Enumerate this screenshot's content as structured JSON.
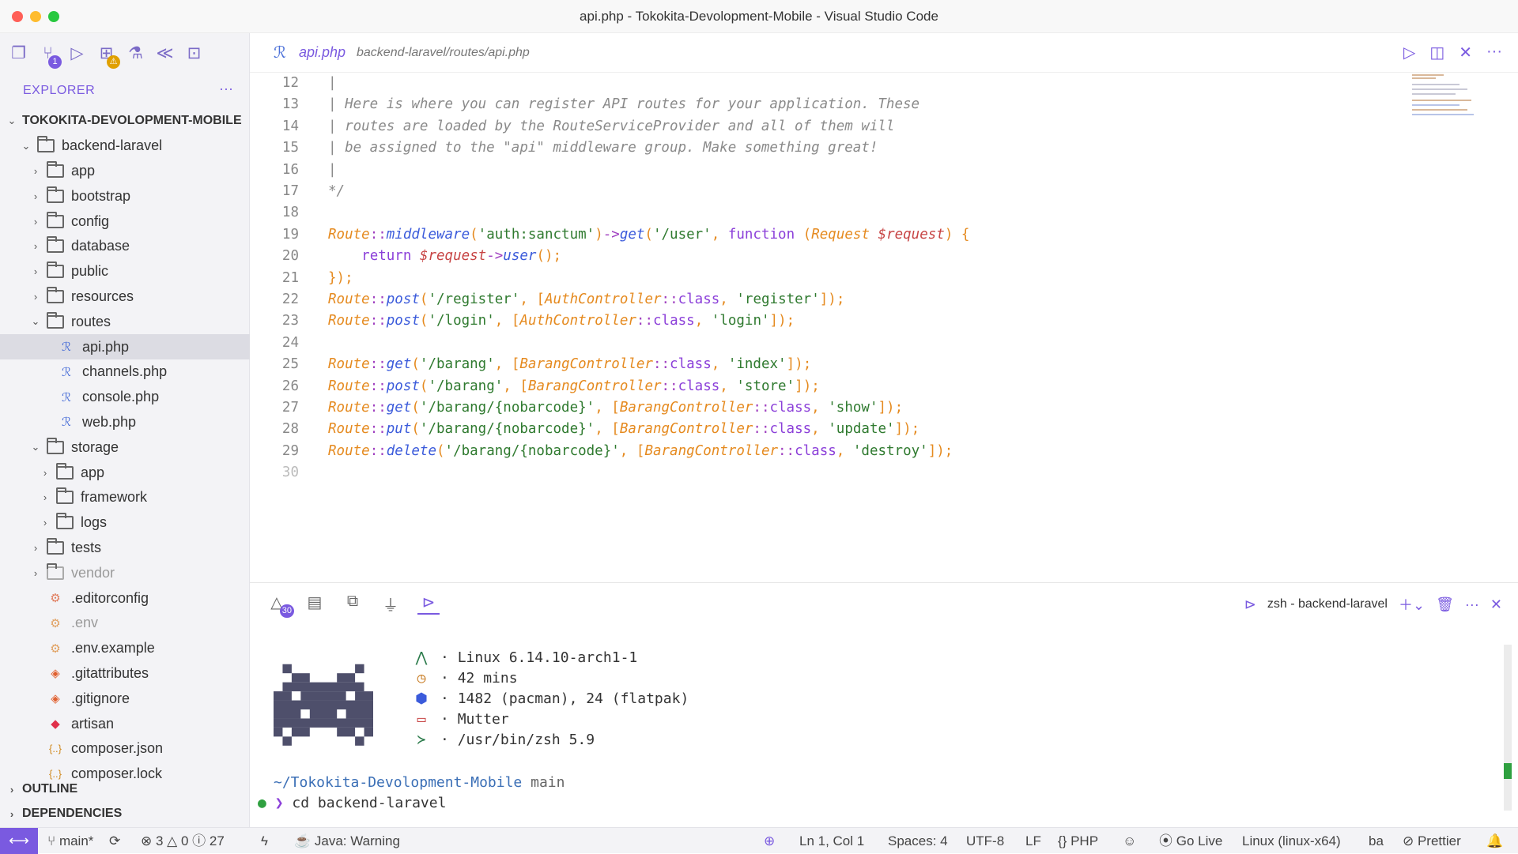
{
  "window": {
    "title": "api.php - Tokokita-Devolopment-Mobile - Visual Studio Code"
  },
  "activity": {
    "scm_badge": "1",
    "warn_badge": "⚠"
  },
  "sidebar": {
    "header": "EXPLORER",
    "more": "···",
    "root": "TOKOKITA-DEVOLOPMENT-MOBILE",
    "items": [
      {
        "label": "backend-laravel"
      },
      {
        "label": "app"
      },
      {
        "label": "bootstrap"
      },
      {
        "label": "config"
      },
      {
        "label": "database"
      },
      {
        "label": "public"
      },
      {
        "label": "resources"
      },
      {
        "label": "routes"
      },
      {
        "label": "api.php"
      },
      {
        "label": "channels.php"
      },
      {
        "label": "console.php"
      },
      {
        "label": "web.php"
      },
      {
        "label": "storage"
      },
      {
        "label": "app"
      },
      {
        "label": "framework"
      },
      {
        "label": "logs"
      },
      {
        "label": "tests"
      },
      {
        "label": "vendor"
      },
      {
        "label": ".editorconfig"
      },
      {
        "label": ".env"
      },
      {
        "label": ".env.example"
      },
      {
        "label": ".gitattributes"
      },
      {
        "label": ".gitignore"
      },
      {
        "label": "artisan"
      },
      {
        "label": "composer.json"
      },
      {
        "label": "composer.lock"
      }
    ],
    "outline": "OUTLINE",
    "dependencies": "DEPENDENCIES"
  },
  "editor": {
    "tab": {
      "name": "api.php",
      "path": "backend-laravel/routes/api.php"
    },
    "lines": [
      {
        "n": "12",
        "t": "|"
      },
      {
        "n": "13",
        "t": "| Here is where you can register API routes for your application. These"
      },
      {
        "n": "14",
        "t": "| routes are loaded by the RouteServiceProvider and all of them will"
      },
      {
        "n": "15",
        "t": "| be assigned to the \"api\" middleware group. Make something great!"
      },
      {
        "n": "16",
        "t": "|"
      },
      {
        "n": "17",
        "t": "*/"
      },
      {
        "n": "18",
        "t": ""
      },
      {
        "n": "19",
        "t": "Route::middleware('auth:sanctum')->get('/user', function (Request $request) {"
      },
      {
        "n": "20",
        "t": "    return $request->user();"
      },
      {
        "n": "21",
        "t": "});"
      },
      {
        "n": "22",
        "t": "Route::post('/register', [AuthController::class, 'register']);"
      },
      {
        "n": "23",
        "t": "Route::post('/login', [AuthController::class, 'login']);"
      },
      {
        "n": "24",
        "t": ""
      },
      {
        "n": "25",
        "t": "Route::get('/barang', [BarangController::class, 'index']);"
      },
      {
        "n": "26",
        "t": "Route::post('/barang', [BarangController::class, 'store']);"
      },
      {
        "n": "27",
        "t": "Route::get('/barang/{nobarcode}', [BarangController::class, 'show']);"
      },
      {
        "n": "28",
        "t": "Route::put('/barang/{nobarcode}', [BarangController::class, 'update']);"
      },
      {
        "n": "29",
        "t": "Route::delete('/barang/{nobarcode}', [BarangController::class, 'destroy']);"
      },
      {
        "n": "30",
        "t": ""
      }
    ]
  },
  "panel": {
    "problems_badge": "30",
    "terminal_label": "zsh - backend-laravel",
    "fetch": [
      "Linux 6.14.10-arch1-1",
      "42 mins",
      "1482 (pacman), 24 (flatpak)",
      "Mutter",
      "/usr/bin/zsh 5.9"
    ],
    "cwd": "~/Tokokita-Devolopment-Mobile",
    "branch": "main",
    "command": "cd backend-laravel"
  },
  "status": {
    "branch": "main*",
    "errors": "3",
    "warnings": "0",
    "info": "27",
    "java": "Java: Warning",
    "position": "Ln 1, Col 1",
    "spaces": "Spaces: 4",
    "encoding": "UTF-8",
    "eol": "LF",
    "lang": "PHP",
    "golive": "Go Live",
    "platform": "Linux (linux-x64)",
    "ba": "ba",
    "prettier": "Prettier"
  }
}
